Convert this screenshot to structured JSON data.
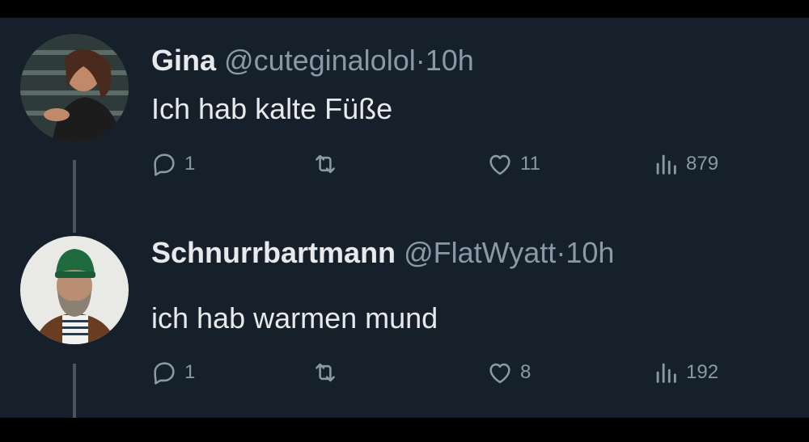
{
  "tweets": [
    {
      "name": "Gina",
      "handle": "@cuteginalolol",
      "separator": "·",
      "time": "10h",
      "text": "Ich hab kalte Füße",
      "replies": "1",
      "likes": "11",
      "views": "879"
    },
    {
      "name": "Schnurrbartmann",
      "handle": "@FlatWyatt",
      "separator": "·",
      "time": "10h",
      "text": "ich hab warmen mund",
      "replies": "1",
      "likes": "8",
      "views": "192"
    }
  ],
  "icons": {
    "reply": "reply-icon",
    "retweet": "retweet-icon",
    "like": "heart-icon",
    "views": "views-icon"
  },
  "colors": {
    "background": "#15202b",
    "text_primary": "#e7e9ea",
    "text_secondary": "#8b98a5",
    "thread_line": "#4b5561"
  }
}
